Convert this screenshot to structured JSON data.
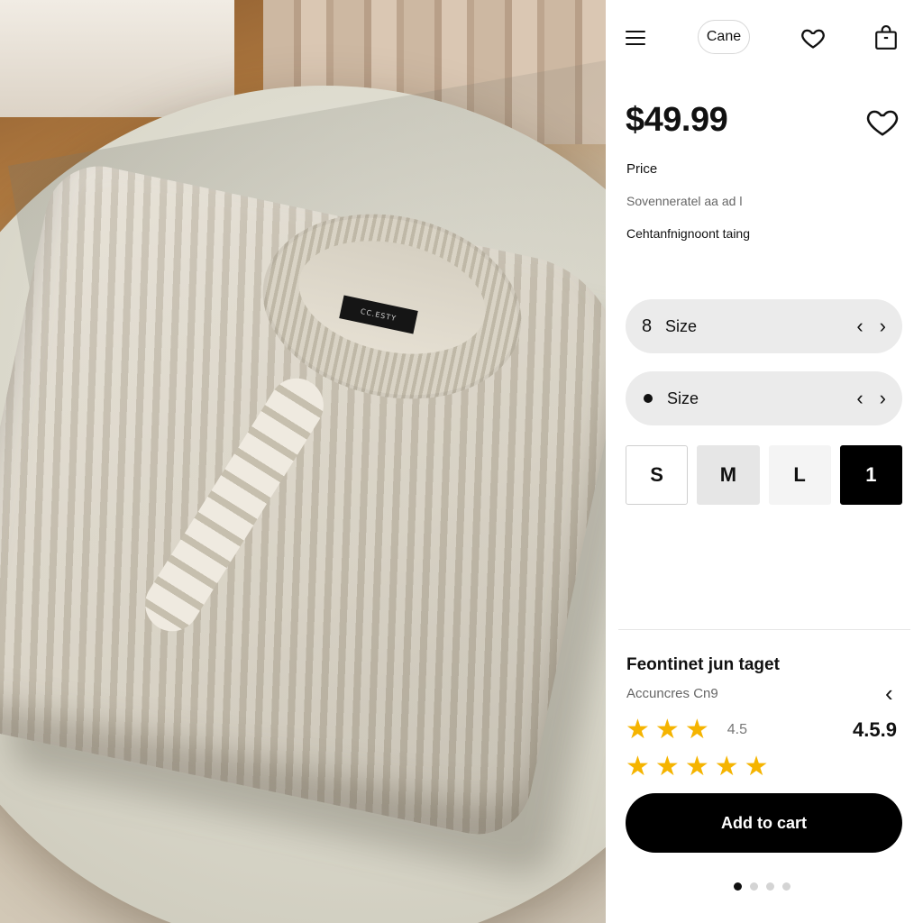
{
  "header": {
    "chip_label": "Cane",
    "icons": [
      "menu-icon",
      "heart-icon",
      "shopping-bag-icon"
    ]
  },
  "product": {
    "price": "$49.99",
    "price_label": "Price",
    "subtitle_1": "Sovenneratel aa ad l",
    "subtitle_2": "Cehtanfnignoont taing",
    "label_tag_text": "CC.ESTY"
  },
  "selectors": [
    {
      "glyph": "8",
      "label": "Size",
      "prev": "‹",
      "next": "›"
    },
    {
      "glyph": "●",
      "label": "Size",
      "prev": "‹",
      "next": "›"
    }
  ],
  "sizes": [
    {
      "label": "S",
      "state": "outlined"
    },
    {
      "label": "M",
      "state": "gray"
    },
    {
      "label": "L",
      "state": "light"
    },
    {
      "label": "1",
      "state": "selected"
    }
  ],
  "review": {
    "title": "Feontinet jun taget",
    "subtitle": "Accuncres Cn9",
    "back_glyph": "‹",
    "rating_small": "4.5",
    "rating_big": "4.5.9",
    "stars_row1": 3,
    "stars_row2": 5
  },
  "cta": {
    "label": "Add to cart"
  },
  "pager": {
    "count": 4,
    "active": 0
  },
  "colors": {
    "star": "#f5b400",
    "cta_bg": "#000000",
    "selector_bg": "#ebebeb"
  }
}
